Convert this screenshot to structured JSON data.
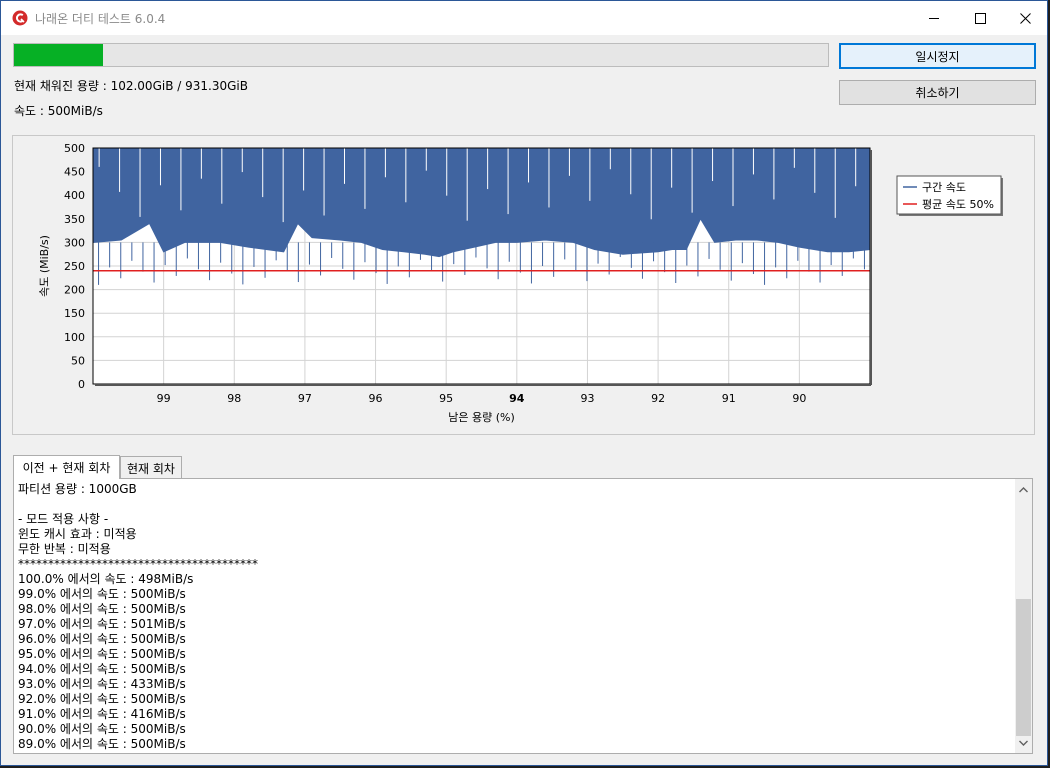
{
  "window": {
    "title": "나래온 더티 테스트 6.0.4"
  },
  "progress": {
    "fraction": 0.1095
  },
  "buttons": {
    "pause_label": "일시정지",
    "cancel_label": "취소하기"
  },
  "status": {
    "filled": "현재 채워진 용량 : 102.00GiB / 931.30GiB",
    "speed": "속도 : 500MiB/s"
  },
  "tabs": [
    {
      "label": "이전 + 현재 회차",
      "active": true
    },
    {
      "label": "현재 회차",
      "active": false
    }
  ],
  "log_lines": [
    "파티션 용량 : 1000GB",
    "",
    "- 모드 적용 사항 -",
    "윈도 캐시 효과 : 미적용",
    "무한 반복 : 미적용",
    "****************************************",
    "100.0% 에서의 속도 : 498MiB/s",
    "99.0% 에서의 속도 : 500MiB/s",
    "98.0% 에서의 속도 : 500MiB/s",
    "97.0% 에서의 속도 : 501MiB/s",
    "96.0% 에서의 속도 : 500MiB/s",
    "95.0% 에서의 속도 : 500MiB/s",
    "94.0% 에서의 속도 : 500MiB/s",
    "93.0% 에서의 속도 : 433MiB/s",
    "92.0% 에서의 속도 : 500MiB/s",
    "91.0% 에서의 속도 : 416MiB/s",
    "90.0% 에서의 속도 : 500MiB/s",
    "89.0% 에서의 속도 : 500MiB/s"
  ],
  "colors": {
    "progress": "#06b025",
    "series": "#4064a0",
    "average": "#e02020",
    "accent": "#0078d7"
  },
  "chart_data": {
    "type": "area",
    "xlabel": "남은 용량 (%)",
    "ylabel": "속도 (MiB/s)",
    "xlim": [
      100,
      89
    ],
    "ylim": [
      0,
      500
    ],
    "yticks": [
      0,
      50,
      100,
      150,
      200,
      250,
      300,
      350,
      400,
      450,
      500
    ],
    "xticks": [
      "99",
      "98",
      "97",
      "96",
      "95",
      "94",
      "93",
      "92",
      "91",
      "90"
    ],
    "xtick_values": [
      99,
      98,
      97,
      96,
      95,
      94,
      93,
      92,
      91,
      90
    ],
    "bold_xtick": "94",
    "grid": true,
    "legend_position": "right",
    "series": [
      {
        "name": "구간 속도",
        "x": [
          100,
          99.6,
          99.2,
          99.0,
          98.7,
          98.2,
          97.8,
          97.3,
          97.1,
          96.9,
          96.5,
          96.2,
          95.9,
          95.6,
          95.3,
          95.1,
          94.9,
          94.6,
          94.3,
          94.0,
          93.6,
          93.2,
          92.9,
          92.5,
          92.0,
          91.8,
          91.6,
          91.4,
          91.2,
          90.9,
          90.6,
          90.3,
          90.0,
          89.6,
          89.3,
          89.0
        ],
        "low": [
          300,
          305,
          340,
          280,
          300,
          300,
          290,
          280,
          340,
          310,
          305,
          300,
          285,
          280,
          275,
          270,
          280,
          290,
          300,
          300,
          305,
          300,
          285,
          275,
          280,
          285,
          285,
          350,
          300,
          305,
          305,
          300,
          290,
          280,
          280,
          285
        ],
        "high": [
          500,
          500,
          500,
          500,
          500,
          500,
          500,
          500,
          500,
          500,
          500,
          500,
          500,
          500,
          500,
          500,
          500,
          500,
          500,
          500,
          500,
          500,
          500,
          500,
          500,
          500,
          500,
          500,
          500,
          500,
          500,
          500,
          500,
          500,
          500,
          500
        ]
      },
      {
        "name": "평균 속도 50%",
        "value": 240
      }
    ]
  }
}
